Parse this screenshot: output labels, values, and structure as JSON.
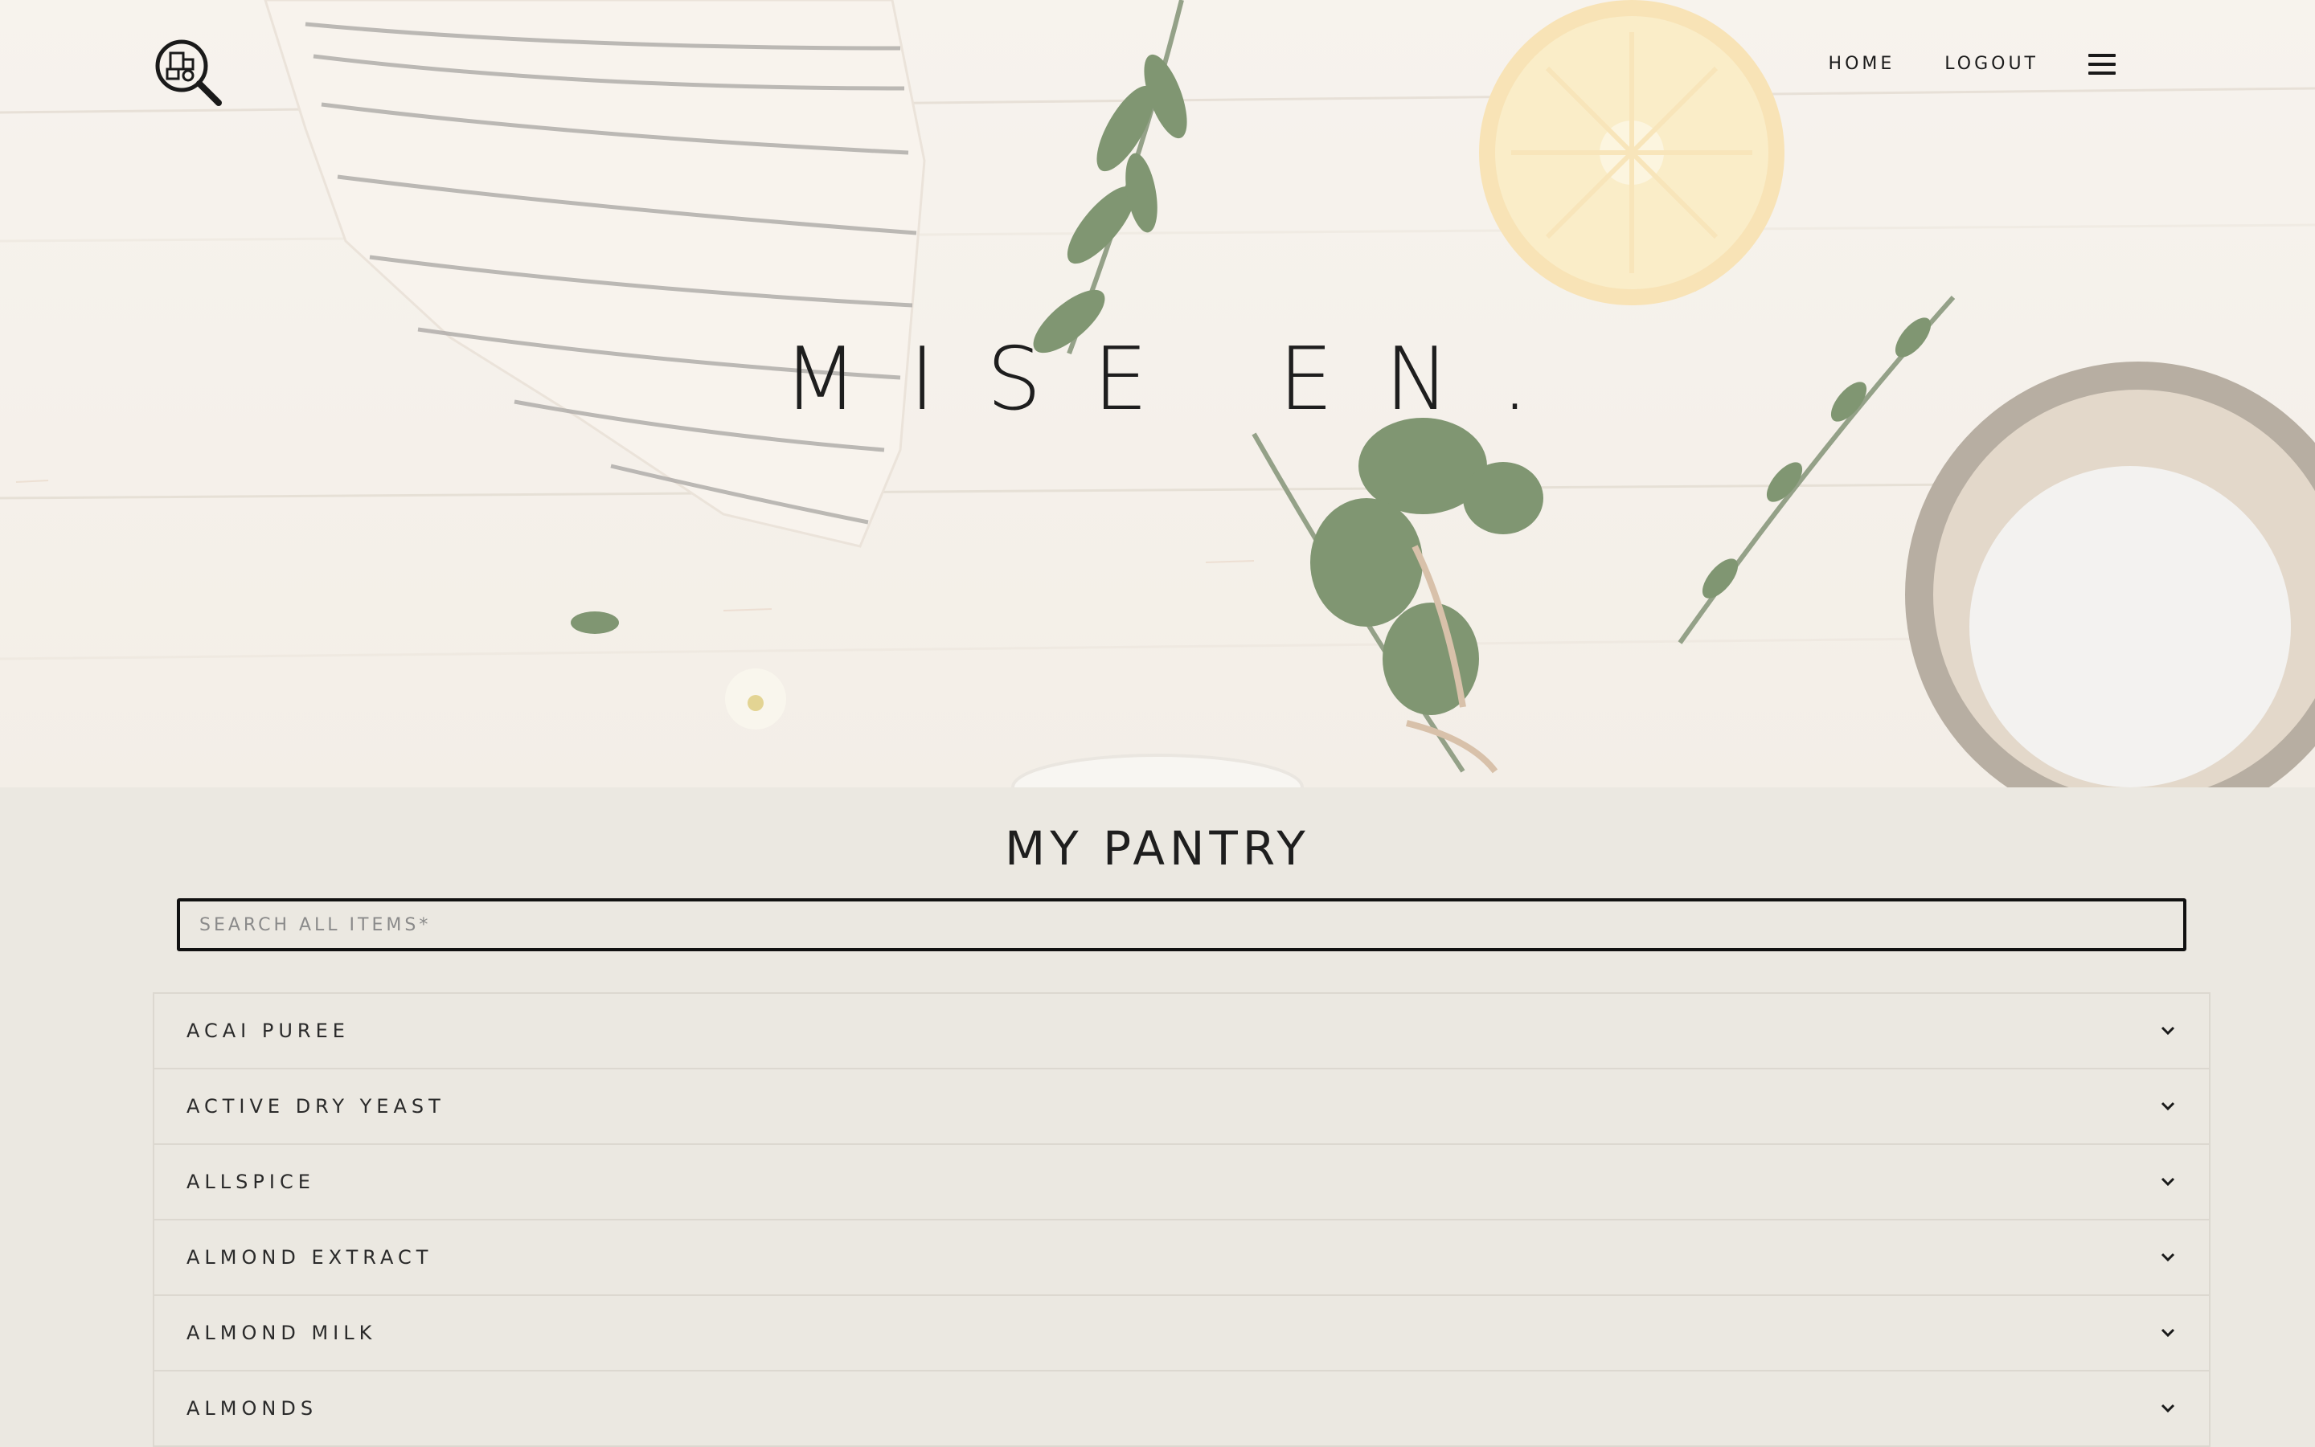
{
  "header": {
    "logo_icon": "pantry-search-logo-icon",
    "nav": {
      "home_label": "HOME",
      "logout_label": "LOGOUT",
      "menu_icon": "hamburger-menu-icon"
    }
  },
  "hero": {
    "title": "MISE EN."
  },
  "pantry": {
    "title": "MY PANTRY",
    "search_placeholder": "SEARCH ALL ITEMS*",
    "search_value": "",
    "items": [
      {
        "label": "ACAI PUREE"
      },
      {
        "label": "ACTIVE DRY YEAST"
      },
      {
        "label": "ALLSPICE"
      },
      {
        "label": "ALMOND EXTRACT"
      },
      {
        "label": "ALMOND MILK"
      },
      {
        "label": "ALMONDS"
      }
    ],
    "row_icon": "chevron-down-icon"
  },
  "colors": {
    "background": "#ebe8e1",
    "text": "#1e1e1e",
    "border": "#dcd8d0",
    "search_border": "#111111"
  }
}
